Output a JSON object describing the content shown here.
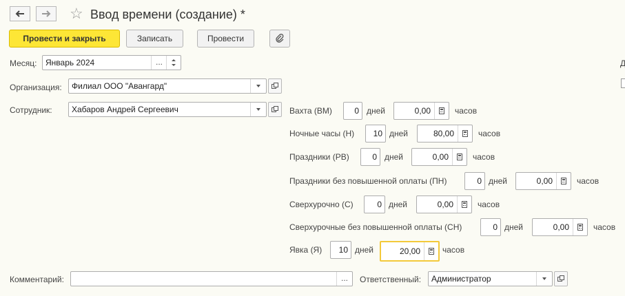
{
  "window": {
    "title": "Ввод времени (создание) *"
  },
  "nav": {
    "back_icon": "arrow-left-icon",
    "forward_icon": "arrow-right-icon",
    "favorite_icon": "star-icon"
  },
  "toolbar": {
    "post_close_label": "Провести и закрыть",
    "save_label": "Записать",
    "post_label": "Провести",
    "attach_icon": "paperclip-icon"
  },
  "form": {
    "month_label": "Месяц:",
    "month_value": "Январь 2024",
    "org_label": "Организация:",
    "org_value": "Филиал ООО \"Авангард\"",
    "employee_label": "Сотрудник:",
    "employee_value": "Хабаров Андрей Сергеевич",
    "comment_label": "Комментарий:",
    "comment_value": "",
    "responsible_label": "Ответственный:",
    "responsible_value": "Администратор",
    "right_edge_label": "Д"
  },
  "time_rows": [
    {
      "label": "Вахта (ВМ)",
      "days": "0",
      "days_unit": "дней",
      "hours": "0,00",
      "hours_unit": "часов"
    },
    {
      "label": "Ночные часы (Н)",
      "days": "10",
      "days_unit": "дней",
      "hours": "80,00",
      "hours_unit": "часов"
    },
    {
      "label": "Праздники (РВ)",
      "days": "0",
      "days_unit": "дней",
      "hours": "0,00",
      "hours_unit": "часов"
    },
    {
      "label": "Праздники без повышенной оплаты (ПН)",
      "days": "0",
      "days_unit": "дней",
      "hours": "0,00",
      "hours_unit": "часов"
    },
    {
      "label": "Сверхурочно (С)",
      "days": "0",
      "days_unit": "дней",
      "hours": "0,00",
      "hours_unit": "часов"
    },
    {
      "label": "Сверхурочные без повышенной оплаты (СН)",
      "days": "0",
      "days_unit": "дней",
      "hours": "0,00",
      "hours_unit": "часов"
    },
    {
      "label": "Явка (Я)",
      "days": "10",
      "days_unit": "дней",
      "hours": "20,00",
      "hours_unit": "часов"
    }
  ]
}
